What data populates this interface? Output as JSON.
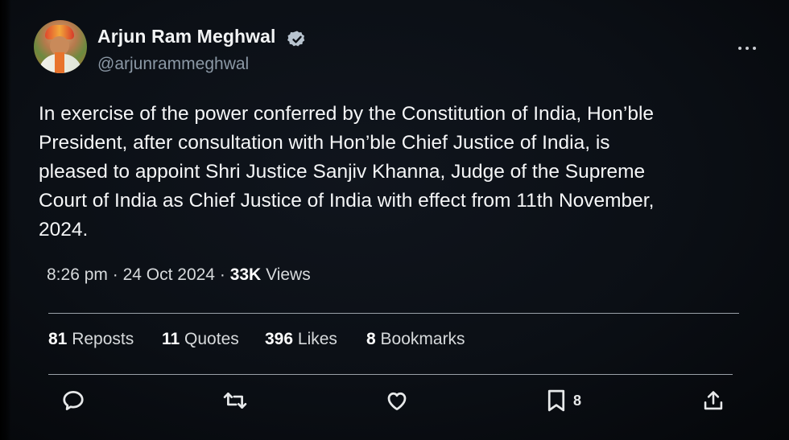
{
  "author": {
    "name": "Arjun Ram Meghwal",
    "handle": "@arjunrammeghwal",
    "verified": true
  },
  "tweet": {
    "lines": [
      "In exercise of the power conferred by the Constitution of India, Hon’ble",
      "President, after consultation with Hon’ble Chief Justice of India, is",
      "pleased to appoint Shri Justice Sanjiv Khanna, Judge of the Supreme",
      "Court of India as Chief Justice of India with effect from 11th November,",
      "2024."
    ]
  },
  "meta": {
    "time": "8:26 pm",
    "separator": "·",
    "date": "24 Oct 2024",
    "views_count": "33K",
    "views_label": "Views"
  },
  "stats": {
    "reposts": {
      "count": "81",
      "label": "Reposts"
    },
    "quotes": {
      "count": "11",
      "label": "Quotes"
    },
    "likes": {
      "count": "396",
      "label": "Likes"
    },
    "bookmarks": {
      "count": "8",
      "label": "Bookmarks"
    }
  },
  "actions": {
    "bookmark_count": "8"
  },
  "colors": {
    "background": "#0b0f15",
    "text": "#e7e9ea",
    "secondary": "#8b98a5",
    "verified_badge": "#b8c4cf",
    "divider": "#9aa1a8"
  },
  "icons": [
    "verified-badge-icon",
    "more-icon",
    "reply-icon",
    "repost-icon",
    "like-icon",
    "bookmark-icon",
    "share-icon"
  ]
}
